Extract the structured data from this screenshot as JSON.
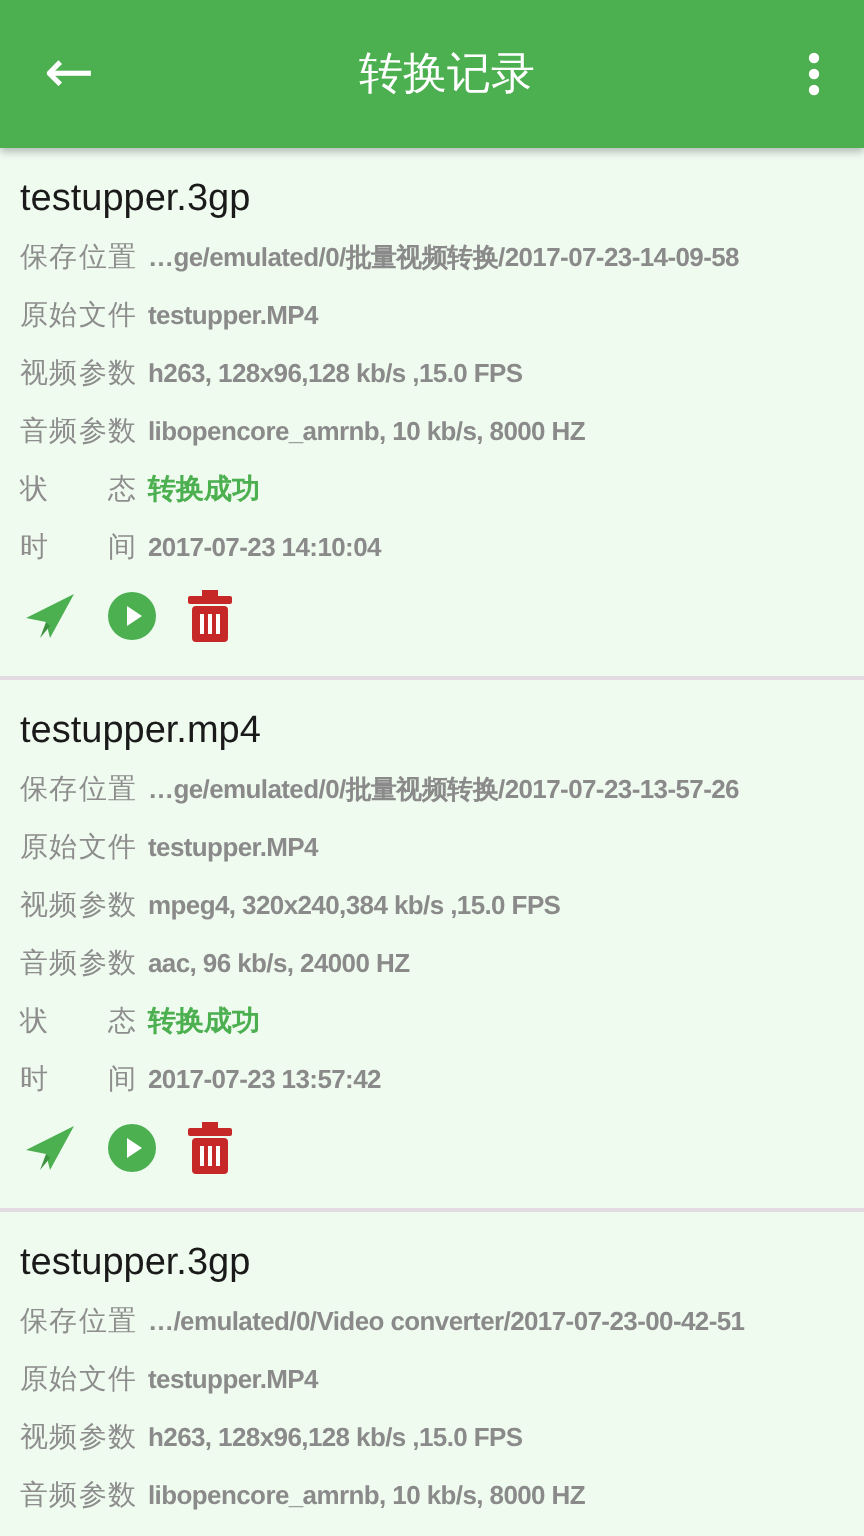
{
  "app_bar": {
    "back_icon": "←",
    "title": "转换记录"
  },
  "records": [
    {
      "title": "testupper.3gp",
      "fields": [
        {
          "label": "保存位置",
          "value": "…ge/emulated/0/批量视频转换/2017-07-23-14-09-58",
          "kind": "plain"
        },
        {
          "label": "原始文件",
          "value": "testupper.MP4",
          "kind": "plain"
        },
        {
          "label": "视频参数",
          "value": "h263, 128x96,128 kb/s ,15.0 FPS",
          "kind": "plain"
        },
        {
          "label": "音频参数",
          "value": "libopencore_amrnb, 10 kb/s, 8000 HZ",
          "kind": "plain"
        },
        {
          "label": "状 态",
          "value": "转换成功",
          "kind": "status"
        },
        {
          "label": "时 间",
          "value": "2017-07-23 14:10:04",
          "kind": "plain"
        }
      ],
      "actions": [
        {
          "kind": "share"
        },
        {
          "kind": "play"
        },
        {
          "kind": "delete"
        }
      ]
    },
    {
      "title": "testupper.mp4",
      "fields": [
        {
          "label": "保存位置",
          "value": "…ge/emulated/0/批量视频转换/2017-07-23-13-57-26",
          "kind": "plain"
        },
        {
          "label": "原始文件",
          "value": "testupper.MP4",
          "kind": "plain"
        },
        {
          "label": "视频参数",
          "value": "mpeg4, 320x240,384 kb/s ,15.0 FPS",
          "kind": "plain"
        },
        {
          "label": "音频参数",
          "value": "aac, 96 kb/s, 24000 HZ",
          "kind": "plain"
        },
        {
          "label": "状 态",
          "value": "转换成功",
          "kind": "status"
        },
        {
          "label": "时 间",
          "value": "2017-07-23 13:57:42",
          "kind": "plain"
        }
      ],
      "actions": [
        {
          "kind": "share"
        },
        {
          "kind": "play"
        },
        {
          "kind": "delete"
        }
      ]
    },
    {
      "title": "testupper.3gp",
      "fields": [
        {
          "label": "保存位置",
          "value": "…/emulated/0/Video converter/2017-07-23-00-42-51",
          "kind": "plain"
        },
        {
          "label": "原始文件",
          "value": "testupper.MP4",
          "kind": "plain"
        },
        {
          "label": "视频参数",
          "value": "h263, 128x96,128 kb/s ,15.0 FPS",
          "kind": "plain"
        },
        {
          "label": "音频参数",
          "value": "libopencore_amrnb, 10 kb/s, 8000 HZ",
          "kind": "plain"
        }
      ]
    }
  ]
}
